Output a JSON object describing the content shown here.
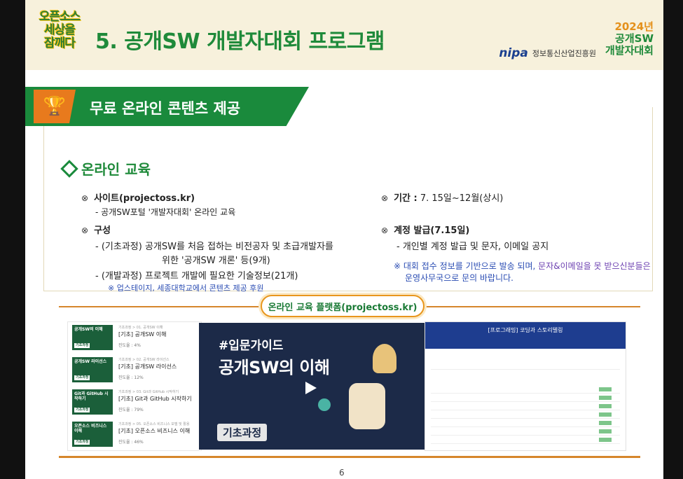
{
  "header": {
    "logo_lines": [
      "오픈소스",
      "세상을",
      "잠깨다"
    ],
    "title": "5. 공개SW 개발자대회 프로그램",
    "brand_year": "2024년",
    "brand_line1": "공개SW",
    "brand_line2": "개발자대회",
    "nipa_mark": "nipa",
    "nipa_org": "정보통신산업진흥원"
  },
  "section": {
    "title": "무료 온라인 콘텐츠 제공",
    "icon": "trophy-icon"
  },
  "edu": {
    "heading": "온라인 교육",
    "site_label": "사이트(projectoss.kr)",
    "site_desc": "- 공개SW포털 '개발자대회' 온라인 교육",
    "composition_label": "구성",
    "basic_line1": "-  (기초과정) 공개SW를 처음 접하는 비전공자 및 초급개발자를",
    "basic_line2": "위한 '공개SW 개론' 등(9개)",
    "dev_line": "-  (개발과정) 프로젝트 개발에 필요한 기술정보(21개)",
    "dev_note": "※ 업스테이지, 세종대학교에서 콘텐츠 제공 후원",
    "period_label": "기간 :",
    "period_value": "7. 15일~12월(상시)",
    "account_label": "계정 발급(7.15일)",
    "account_desc": "-  개인별 계정 발급 및 문자, 이메일 공지",
    "account_note_a": "※ 대회 접수 정보를 기반으로 발송 되며, ",
    "account_note_b": "문자&이메일을 못 받으신분들은",
    "account_note_c": "운영사무국으로 문의 바랍니다."
  },
  "platform": {
    "pill": "온라인 교육 플랫폼(projectoss.kr)",
    "courses": [
      {
        "thumb": "공개SW의 이해",
        "tag": "기초과정",
        "bc": "기초과정 > 01. 공개SW 이해",
        "title": "[기초] 공개SW 이해",
        "progress": "진도율 : 4%"
      },
      {
        "thumb": "공개SW 라이선스",
        "tag": "기초과정",
        "bc": "기초과정 > 02. 공개SW 라이선스",
        "title": "[기초] 공개SW 라이선스",
        "progress": "진도율 : 12%"
      },
      {
        "thumb": "Git과 GitHub 시작하기",
        "tag": "기초과정",
        "bc": "기초과정 > 03. Git과 GitHub 시작하기",
        "title": "[기초] Git과 GitHub 시작하기",
        "progress": "진도율 : 79%"
      },
      {
        "thumb": "오픈소스 비즈니스 이해",
        "tag": "기초과정",
        "bc": "기초과정 > 05. 오픈소스 비즈니스 모델 및 활용",
        "title": "[기초] 오픈소스 비즈니스 이해",
        "progress": "진도율 : 46%"
      }
    ],
    "video_tag": "#입문가이드",
    "video_title": "공개SW의 이해",
    "video_badge": "기초과정",
    "portal_title": "[프로그래밍] 코딩과 스토리텔링"
  },
  "footer": {
    "page": "6"
  }
}
